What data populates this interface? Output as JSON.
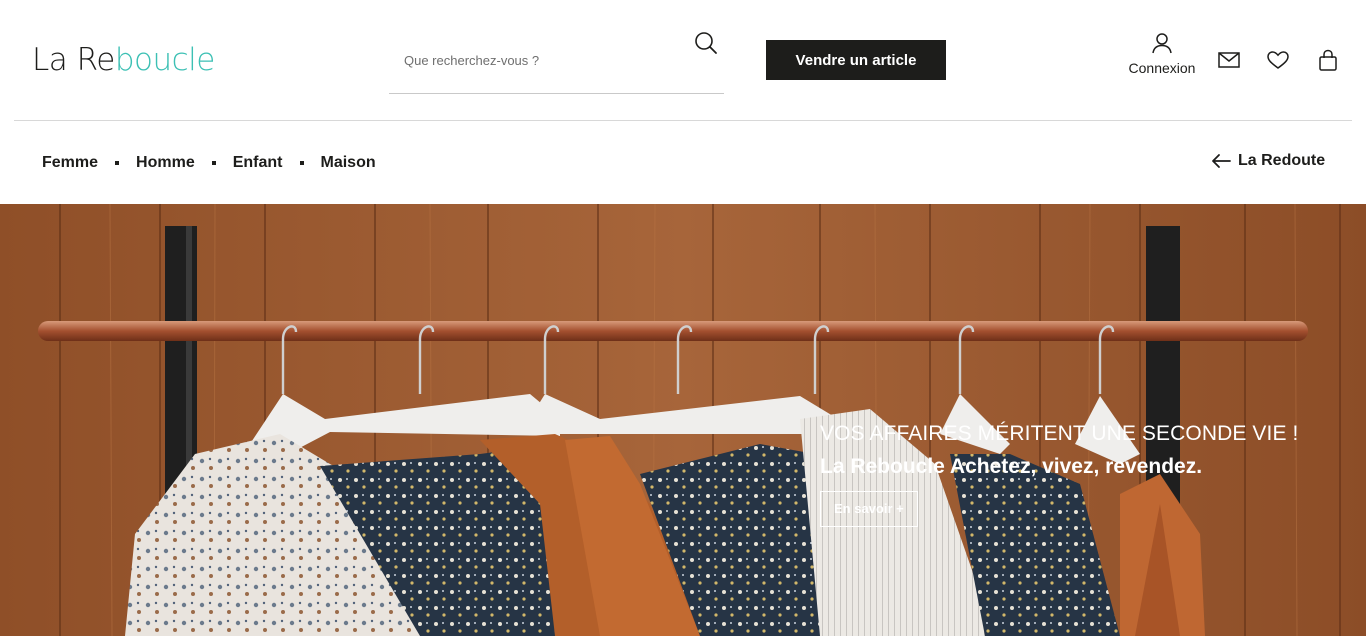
{
  "brand": {
    "name_part1": "La Re",
    "name_part2": "boucle",
    "accent_color": "#3cc0b4"
  },
  "search": {
    "placeholder": "Que recherchez-vous ?",
    "value": "",
    "icon": "search-icon"
  },
  "header": {
    "sell_button": "Vendre un article",
    "account_label": "Connexion",
    "icons": [
      "user-icon",
      "mail-icon",
      "heart-icon",
      "shopping-bag-icon"
    ]
  },
  "nav": {
    "items": [
      "Femme",
      "Homme",
      "Enfant",
      "Maison"
    ],
    "back_link": "La Redoute",
    "back_icon": "arrow-left-icon"
  },
  "hero": {
    "kicker": "VOS AFFAIRES MÉRITENT UNE SECONDE VIE !",
    "title": "La Reboucle Achetez, vivez, revendez.",
    "cta": "En savoir +"
  }
}
